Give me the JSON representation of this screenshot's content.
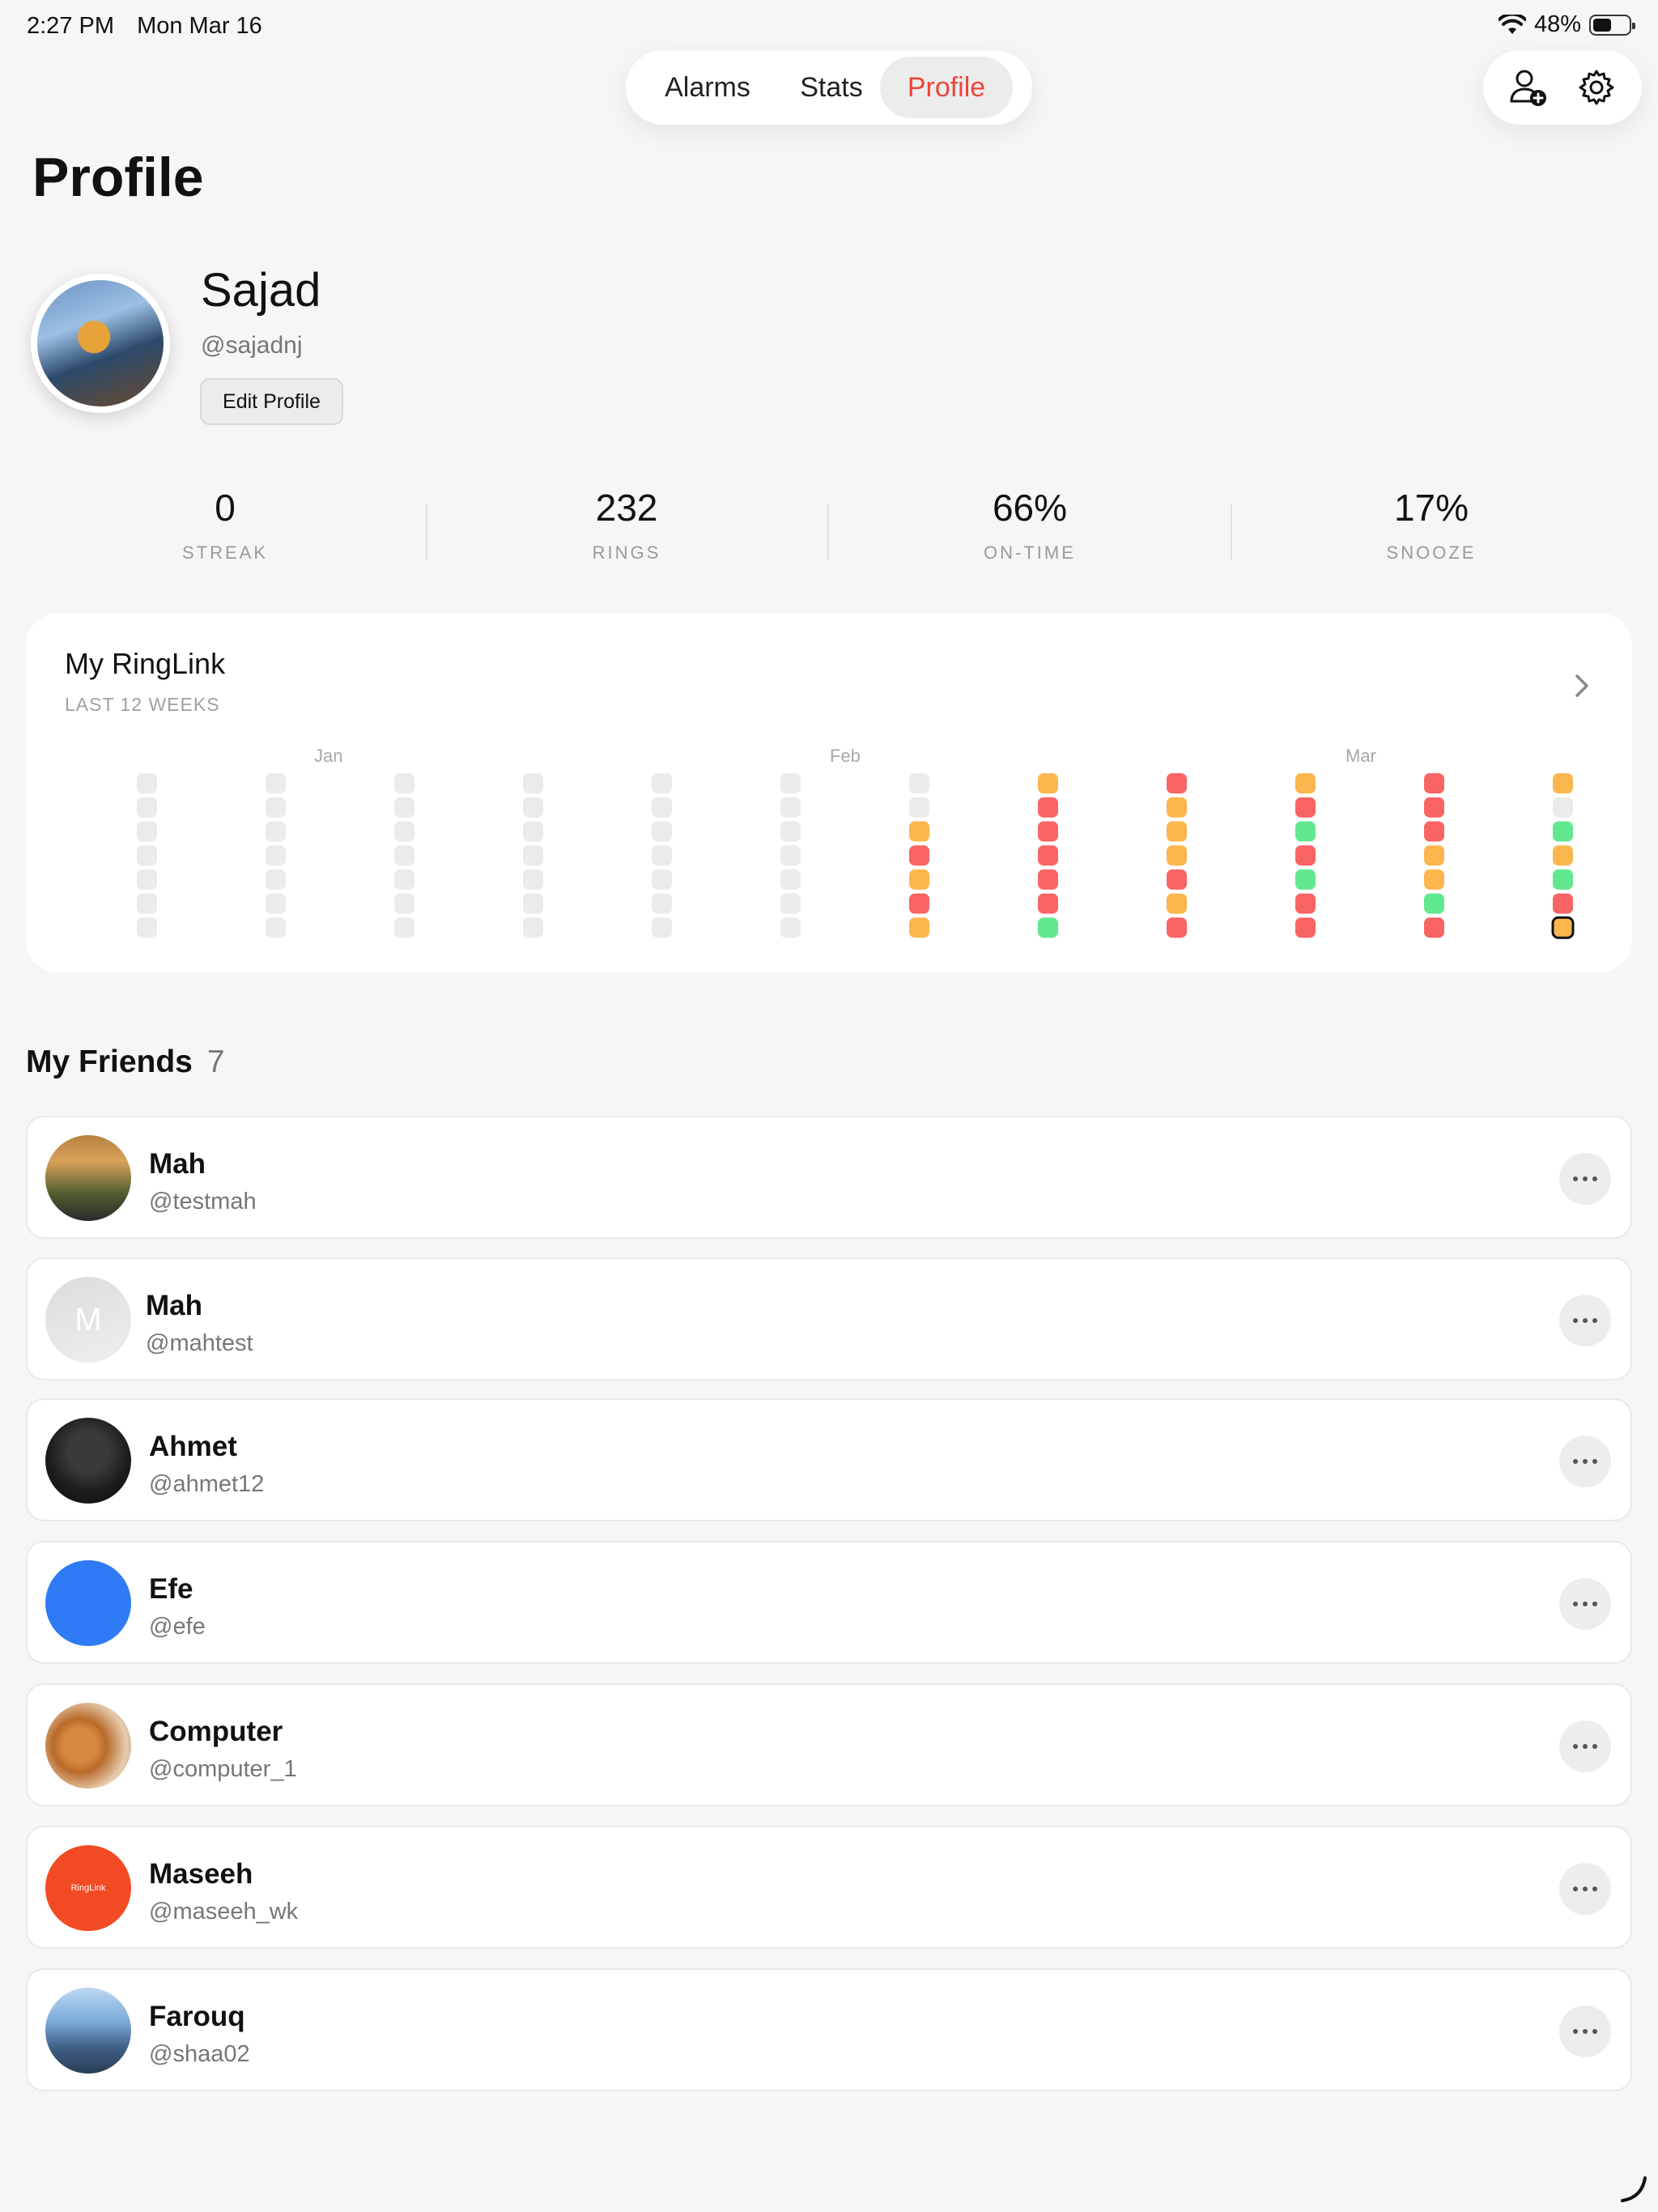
{
  "status": {
    "time": "2:27 PM",
    "date": "Mon Mar 16",
    "battery": "48%",
    "battery_level": 0.48
  },
  "nav": {
    "tabs": [
      "Alarms",
      "Stats",
      "Profile"
    ],
    "active": "Profile"
  },
  "page": {
    "title": "Profile"
  },
  "profile": {
    "name": "Sajad",
    "handle": "@sajadnj",
    "edit_label": "Edit Profile"
  },
  "stats": [
    {
      "value": "0",
      "label": "STREAK"
    },
    {
      "value": "232",
      "label": "RINGS"
    },
    {
      "value": "66%",
      "label": "ON-TIME"
    },
    {
      "value": "17%",
      "label": "SNOOZE"
    }
  ],
  "ringlink": {
    "title": "My RingLink",
    "subtitle": "LAST 12 WEEKS",
    "months": [
      "Jan",
      "Feb",
      "Mar"
    ],
    "colors": {
      "empty": "#ebebeb",
      "orange": "#fbb64e",
      "red": "#f86464",
      "green": "#61e88f"
    },
    "weeks": [
      [
        "empty",
        "empty",
        "empty",
        "empty",
        "empty",
        "empty",
        "empty"
      ],
      [
        "empty",
        "empty",
        "empty",
        "empty",
        "empty",
        "empty",
        "empty"
      ],
      [
        "empty",
        "empty",
        "empty",
        "empty",
        "empty",
        "empty",
        "empty"
      ],
      [
        "empty",
        "empty",
        "empty",
        "empty",
        "empty",
        "empty",
        "empty"
      ],
      [
        "empty",
        "empty",
        "empty",
        "empty",
        "empty",
        "empty",
        "empty"
      ],
      [
        "empty",
        "empty",
        "empty",
        "empty",
        "empty",
        "empty",
        "empty"
      ],
      [
        "empty",
        "empty",
        "orange",
        "red",
        "orange",
        "red",
        "orange"
      ],
      [
        "orange",
        "red",
        "red",
        "red",
        "red",
        "red",
        "green"
      ],
      [
        "red",
        "orange",
        "orange",
        "orange",
        "red",
        "orange",
        "red"
      ],
      [
        "orange",
        "red",
        "green",
        "red",
        "green",
        "red",
        "red"
      ],
      [
        "red",
        "red",
        "red",
        "orange",
        "orange",
        "green",
        "red"
      ],
      [
        "orange",
        "empty",
        "green",
        "orange",
        "green",
        "red",
        "orange"
      ]
    ],
    "today": {
      "week": 11,
      "day": 6
    }
  },
  "friends": {
    "title": "My Friends",
    "count": "7",
    "items": [
      {
        "name": "Mah",
        "handle": "@testmah",
        "avatar": "photo-sunset"
      },
      {
        "name": "Mah",
        "handle": "@mahtest",
        "avatar": "initial",
        "initial": "M"
      },
      {
        "name": "Ahmet",
        "handle": "@ahmet12",
        "avatar": "photo-dark"
      },
      {
        "name": "Efe",
        "handle": "@efe",
        "avatar": "solid-blue"
      },
      {
        "name": "Computer",
        "handle": "@computer_1",
        "avatar": "photo-cat"
      },
      {
        "name": "Maseeh",
        "handle": "@maseeh_wk",
        "avatar": "logo",
        "logo_text": "RingLink"
      },
      {
        "name": "Farouq",
        "handle": "@shaa02",
        "avatar": "photo-mountain"
      }
    ]
  },
  "icons": {
    "add_friend": "person-plus-icon",
    "settings": "gear-icon",
    "chevron": "chevron-right-icon",
    "more": "ellipsis-icon"
  }
}
